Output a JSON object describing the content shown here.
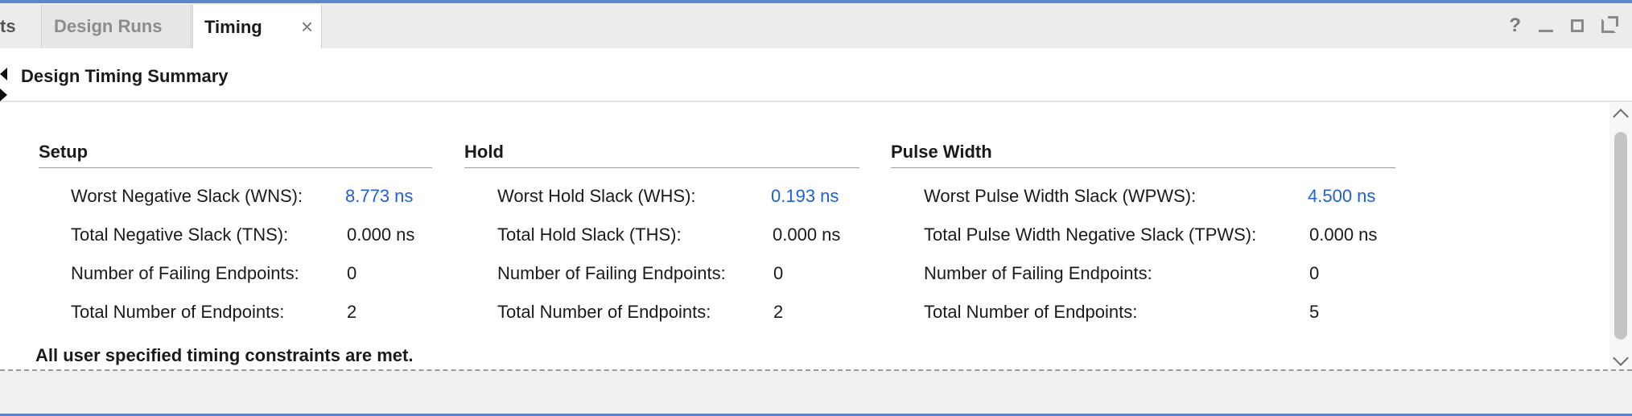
{
  "tabs": [
    {
      "label": "ts",
      "active": false
    },
    {
      "label": "Design Runs",
      "active": false
    },
    {
      "label": "Timing",
      "active": true
    }
  ],
  "tab_close_glyph": "×",
  "window_controls": [
    "help-icon",
    "minimize-icon",
    "maximize-icon",
    "float-icon"
  ],
  "window_help_glyph": "?",
  "section": {
    "title": "Design Timing Summary"
  },
  "setup": {
    "header": "Setup",
    "rows": [
      {
        "label": "Worst Negative Slack (WNS):",
        "value": "8.773 ns",
        "link": true
      },
      {
        "label": "Total Negative Slack (TNS):",
        "value": "0.000 ns",
        "link": false
      },
      {
        "label": "Number of Failing Endpoints:",
        "value": "0",
        "link": false
      },
      {
        "label": "Total Number of Endpoints:",
        "value": "2",
        "link": false
      }
    ]
  },
  "hold": {
    "header": "Hold",
    "rows": [
      {
        "label": "Worst Hold Slack (WHS):",
        "value": "0.193 ns",
        "link": true
      },
      {
        "label": "Total Hold Slack (THS):",
        "value": "0.000 ns",
        "link": false
      },
      {
        "label": "Number of Failing Endpoints:",
        "value": "0",
        "link": false
      },
      {
        "label": "Total Number of Endpoints:",
        "value": "2",
        "link": false
      }
    ]
  },
  "pulse_width": {
    "header": "Pulse Width",
    "rows": [
      {
        "label": "Worst Pulse Width Slack (WPWS):",
        "value": "4.500 ns",
        "link": true
      },
      {
        "label": "Total Pulse Width Negative Slack (TPWS):",
        "value": "0.000 ns",
        "link": false
      },
      {
        "label": "Number of Failing Endpoints:",
        "value": "0",
        "link": false
      },
      {
        "label": "Total Number of Endpoints:",
        "value": "5",
        "link": false
      }
    ]
  },
  "summary_message": "All user specified timing constraints are met.",
  "colors": {
    "link": "#1f5fd6",
    "accent_border": "#5b86c9"
  }
}
